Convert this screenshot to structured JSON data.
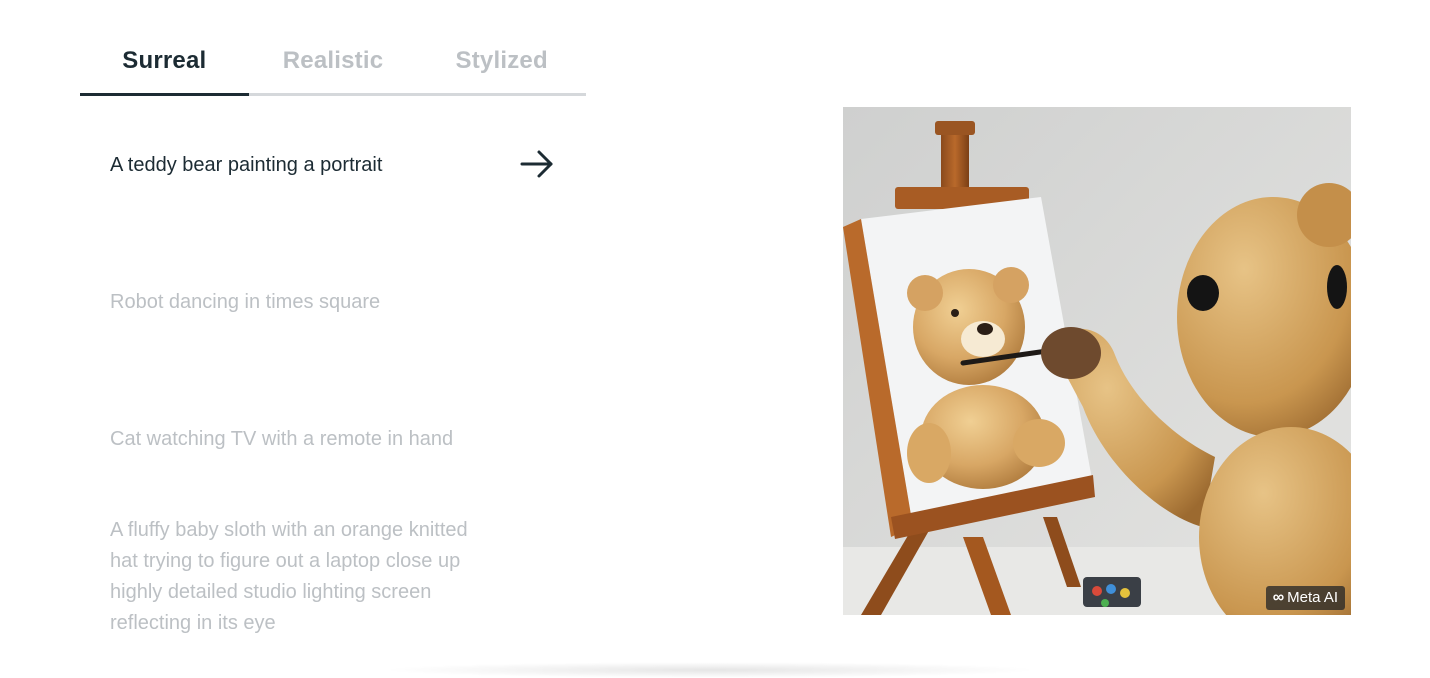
{
  "tabs": [
    {
      "label": "Surreal",
      "active": true
    },
    {
      "label": "Realistic",
      "active": false
    },
    {
      "label": "Stylized",
      "active": false
    }
  ],
  "prompts": [
    {
      "text": "A teddy bear painting a portrait",
      "active": true
    },
    {
      "text": "Robot dancing in times square",
      "active": false
    },
    {
      "text": "Cat watching TV with a remote in hand",
      "active": false
    },
    {
      "text": "A fluffy baby sloth with an orange knitted hat trying to figure out a laptop close up highly detailed studio lighting screen reflecting in its eye",
      "active": false
    }
  ],
  "preview": {
    "watermark": "Meta AI",
    "watermark_logo": "∞"
  },
  "colors": {
    "active_text": "#1c2b33",
    "inactive_text": "#bcc0c4",
    "tab_underline": "#d5d8db"
  },
  "icons": {
    "submit": "arrow-right-icon"
  }
}
